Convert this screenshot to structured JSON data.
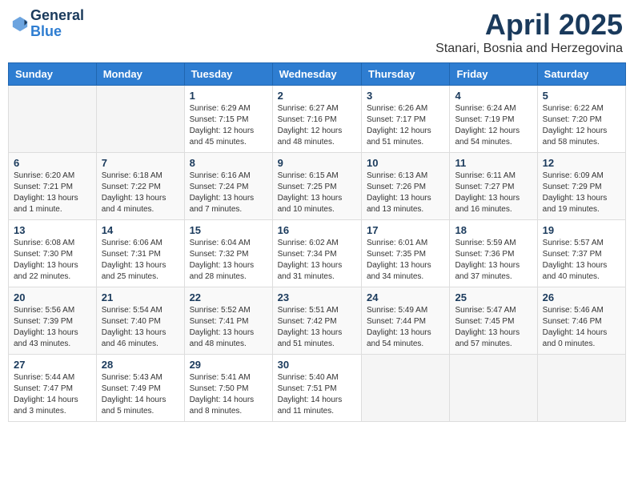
{
  "header": {
    "logo_general": "General",
    "logo_blue": "Blue",
    "month": "April 2025",
    "location": "Stanari, Bosnia and Herzegovina"
  },
  "days_of_week": [
    "Sunday",
    "Monday",
    "Tuesday",
    "Wednesday",
    "Thursday",
    "Friday",
    "Saturday"
  ],
  "weeks": [
    [
      {
        "day": "",
        "info": ""
      },
      {
        "day": "",
        "info": ""
      },
      {
        "day": "1",
        "info": "Sunrise: 6:29 AM\nSunset: 7:15 PM\nDaylight: 12 hours and 45 minutes."
      },
      {
        "day": "2",
        "info": "Sunrise: 6:27 AM\nSunset: 7:16 PM\nDaylight: 12 hours and 48 minutes."
      },
      {
        "day": "3",
        "info": "Sunrise: 6:26 AM\nSunset: 7:17 PM\nDaylight: 12 hours and 51 minutes."
      },
      {
        "day": "4",
        "info": "Sunrise: 6:24 AM\nSunset: 7:19 PM\nDaylight: 12 hours and 54 minutes."
      },
      {
        "day": "5",
        "info": "Sunrise: 6:22 AM\nSunset: 7:20 PM\nDaylight: 12 hours and 58 minutes."
      }
    ],
    [
      {
        "day": "6",
        "info": "Sunrise: 6:20 AM\nSunset: 7:21 PM\nDaylight: 13 hours and 1 minute."
      },
      {
        "day": "7",
        "info": "Sunrise: 6:18 AM\nSunset: 7:22 PM\nDaylight: 13 hours and 4 minutes."
      },
      {
        "day": "8",
        "info": "Sunrise: 6:16 AM\nSunset: 7:24 PM\nDaylight: 13 hours and 7 minutes."
      },
      {
        "day": "9",
        "info": "Sunrise: 6:15 AM\nSunset: 7:25 PM\nDaylight: 13 hours and 10 minutes."
      },
      {
        "day": "10",
        "info": "Sunrise: 6:13 AM\nSunset: 7:26 PM\nDaylight: 13 hours and 13 minutes."
      },
      {
        "day": "11",
        "info": "Sunrise: 6:11 AM\nSunset: 7:27 PM\nDaylight: 13 hours and 16 minutes."
      },
      {
        "day": "12",
        "info": "Sunrise: 6:09 AM\nSunset: 7:29 PM\nDaylight: 13 hours and 19 minutes."
      }
    ],
    [
      {
        "day": "13",
        "info": "Sunrise: 6:08 AM\nSunset: 7:30 PM\nDaylight: 13 hours and 22 minutes."
      },
      {
        "day": "14",
        "info": "Sunrise: 6:06 AM\nSunset: 7:31 PM\nDaylight: 13 hours and 25 minutes."
      },
      {
        "day": "15",
        "info": "Sunrise: 6:04 AM\nSunset: 7:32 PM\nDaylight: 13 hours and 28 minutes."
      },
      {
        "day": "16",
        "info": "Sunrise: 6:02 AM\nSunset: 7:34 PM\nDaylight: 13 hours and 31 minutes."
      },
      {
        "day": "17",
        "info": "Sunrise: 6:01 AM\nSunset: 7:35 PM\nDaylight: 13 hours and 34 minutes."
      },
      {
        "day": "18",
        "info": "Sunrise: 5:59 AM\nSunset: 7:36 PM\nDaylight: 13 hours and 37 minutes."
      },
      {
        "day": "19",
        "info": "Sunrise: 5:57 AM\nSunset: 7:37 PM\nDaylight: 13 hours and 40 minutes."
      }
    ],
    [
      {
        "day": "20",
        "info": "Sunrise: 5:56 AM\nSunset: 7:39 PM\nDaylight: 13 hours and 43 minutes."
      },
      {
        "day": "21",
        "info": "Sunrise: 5:54 AM\nSunset: 7:40 PM\nDaylight: 13 hours and 46 minutes."
      },
      {
        "day": "22",
        "info": "Sunrise: 5:52 AM\nSunset: 7:41 PM\nDaylight: 13 hours and 48 minutes."
      },
      {
        "day": "23",
        "info": "Sunrise: 5:51 AM\nSunset: 7:42 PM\nDaylight: 13 hours and 51 minutes."
      },
      {
        "day": "24",
        "info": "Sunrise: 5:49 AM\nSunset: 7:44 PM\nDaylight: 13 hours and 54 minutes."
      },
      {
        "day": "25",
        "info": "Sunrise: 5:47 AM\nSunset: 7:45 PM\nDaylight: 13 hours and 57 minutes."
      },
      {
        "day": "26",
        "info": "Sunrise: 5:46 AM\nSunset: 7:46 PM\nDaylight: 14 hours and 0 minutes."
      }
    ],
    [
      {
        "day": "27",
        "info": "Sunrise: 5:44 AM\nSunset: 7:47 PM\nDaylight: 14 hours and 3 minutes."
      },
      {
        "day": "28",
        "info": "Sunrise: 5:43 AM\nSunset: 7:49 PM\nDaylight: 14 hours and 5 minutes."
      },
      {
        "day": "29",
        "info": "Sunrise: 5:41 AM\nSunset: 7:50 PM\nDaylight: 14 hours and 8 minutes."
      },
      {
        "day": "30",
        "info": "Sunrise: 5:40 AM\nSunset: 7:51 PM\nDaylight: 14 hours and 11 minutes."
      },
      {
        "day": "",
        "info": ""
      },
      {
        "day": "",
        "info": ""
      },
      {
        "day": "",
        "info": ""
      }
    ]
  ]
}
